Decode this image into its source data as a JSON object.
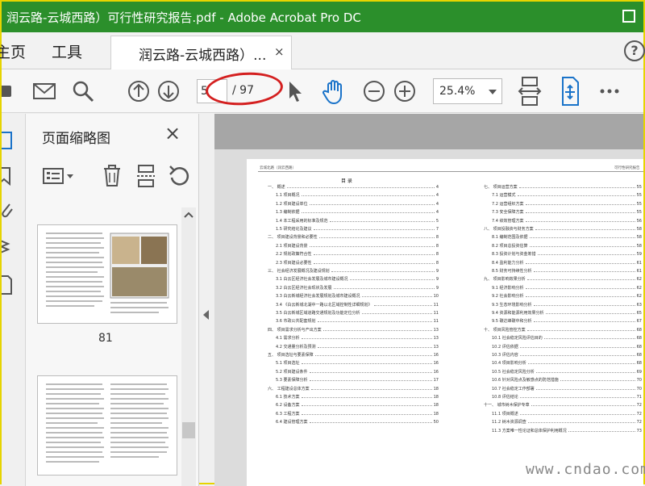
{
  "window": {
    "title": "润云路-云城西路）可行性研究报告.pdf - Adobe Acrobat Pro DC"
  },
  "tabs": {
    "home_label": "主页",
    "tools_label": "工具",
    "document_label": "润云路-云城西路）...",
    "close_glyph": "×",
    "help_glyph": "?"
  },
  "toolbar": {
    "page_current": "5",
    "page_total": "/ 97",
    "zoom": "25.4%"
  },
  "thumb_panel": {
    "title": "页面缩略图",
    "close_glyph": "×",
    "page_label": "81"
  },
  "document": {
    "header_left": "云城北路（润云西路）",
    "header_right": "可行性研究报告",
    "toc_title": "目  录",
    "toc_left": [
      {
        "t": "一、  概述",
        "p": "4"
      },
      {
        "t": "1.1 项目概况",
        "p": "4"
      },
      {
        "t": "1.2 项目建设单位",
        "p": "4"
      },
      {
        "t": "1.3 编制依据",
        "p": "4"
      },
      {
        "t": "1.4 本工程采用的标准及规范",
        "p": "5"
      },
      {
        "t": "1.5 研究结论及建议",
        "p": "7"
      },
      {
        "t": "二、  项目建设背景和必要性",
        "p": "8"
      },
      {
        "t": "2.1 项目建设背景",
        "p": "8"
      },
      {
        "t": "2.2 规划政策符合性",
        "p": "8"
      },
      {
        "t": "2.3 项目建设必要性",
        "p": "8"
      },
      {
        "t": "三、  社会经济发展概况及建设规划",
        "p": "9"
      },
      {
        "t": "3.1 白云区经济社会发展及城市建设概况",
        "p": "9"
      },
      {
        "t": "3.2 白云区经济社会现状及发展",
        "p": "9"
      },
      {
        "t": "3.3 白云新城经济社会发展规划及城市建设概况",
        "p": "10"
      },
      {
        "t": "3.4 《白云新城北湖中一路以北区域控制性详细规划》",
        "p": "11"
      },
      {
        "t": "3.5 白云新城区域道路交通规划及功能定位分析",
        "p": "11"
      },
      {
        "t": "3.6 市政公共配套规划",
        "p": "11"
      },
      {
        "t": "四、  项目需求分析与产出方案",
        "p": "13"
      },
      {
        "t": "4.1 需求分析",
        "p": "13"
      },
      {
        "t": "4.2 交通量分析及预测",
        "p": "13"
      },
      {
        "t": "五、  项目选址与要素保障",
        "p": "16"
      },
      {
        "t": "5.1 项目选址",
        "p": "16"
      },
      {
        "t": "5.2 项目建设条件",
        "p": "16"
      },
      {
        "t": "5.3 要素保障分析",
        "p": "17"
      },
      {
        "t": "六、  工程建设总体方案",
        "p": "18"
      },
      {
        "t": "6.1 技术方案",
        "p": "18"
      },
      {
        "t": "6.2 设备方案",
        "p": "18"
      },
      {
        "t": "6.3 工程方案",
        "p": "18"
      },
      {
        "t": "6.4 建设管理方案",
        "p": "50"
      }
    ],
    "toc_right": [
      {
        "t": "七、  项目运营方案",
        "p": "55"
      },
      {
        "t": "7.1 运营模式",
        "p": "55"
      },
      {
        "t": "7.2 运营组织方案",
        "p": "55"
      },
      {
        "t": "7.3 安全保障方案",
        "p": "55"
      },
      {
        "t": "7.4 绩效管理方案",
        "p": "56"
      },
      {
        "t": "八、  项目投融资与财务方案",
        "p": "58"
      },
      {
        "t": "8.1 编制范围及依据",
        "p": "58"
      },
      {
        "t": "8.2 项目总投资估算",
        "p": "58"
      },
      {
        "t": "8.3 投资计划与资金筹措",
        "p": "59"
      },
      {
        "t": "8.4 盈利能力分析",
        "p": "61"
      },
      {
        "t": "8.5 财务可持续性分析",
        "p": "61"
      },
      {
        "t": "九、  项目影响效果分析",
        "p": "62"
      },
      {
        "t": "9.1 经济影响分析",
        "p": "62"
      },
      {
        "t": "9.2 社会影响分析",
        "p": "62"
      },
      {
        "t": "9.3 生态环境影响分析",
        "p": "63"
      },
      {
        "t": "9.4 资源和能源利用效果分析",
        "p": "65"
      },
      {
        "t": "9.5 碳达峰碳中和分析",
        "p": "67"
      },
      {
        "t": "十、  项目风险管控方案",
        "p": "68"
      },
      {
        "t": "10.1 社会稳定风险评估目的",
        "p": "68"
      },
      {
        "t": "10.2 评估依据",
        "p": "68"
      },
      {
        "t": "10.3 评估内容",
        "p": "68"
      },
      {
        "t": "10.4 项目影响分析",
        "p": "68"
      },
      {
        "t": "10.5 社会稳定风险分析",
        "p": "69"
      },
      {
        "t": "10.6 针对风险点及敏感点的防范措施",
        "p": "70"
      },
      {
        "t": "10.7 社会稳定工作部署",
        "p": "70"
      },
      {
        "t": "10.8 评估结论",
        "p": "71"
      },
      {
        "t": "十一、  城市树木保护专章",
        "p": "72"
      },
      {
        "t": "11.1 项目概述",
        "p": "72"
      },
      {
        "t": "11.2 树木资源调查",
        "p": "72"
      },
      {
        "t": "11.3 方案唯一性论证和总体保护利用概况",
        "p": "73"
      }
    ]
  },
  "watermark": "www.cndao.com",
  "colors": {
    "titlebar": "#2b8f2b",
    "accent_blue": "#1a73c9",
    "annotation_red": "#d42020"
  }
}
